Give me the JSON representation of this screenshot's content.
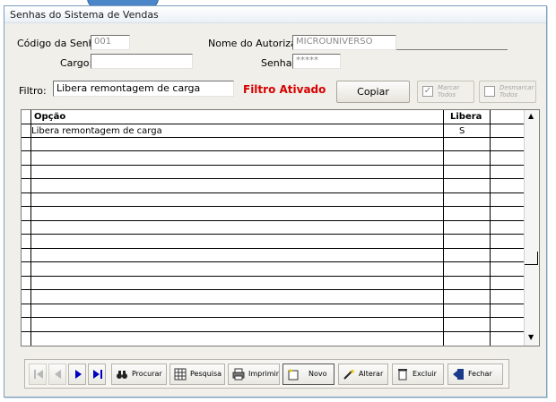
{
  "window": {
    "title": "Senhas do Sistema de Vendas"
  },
  "form": {
    "codigo_label": "Código da Senha:",
    "codigo_value": "001",
    "autorizado_label": "Nome do Autorizado:",
    "autorizado_value": "MICROUNIVERSO",
    "cargo_label": "Cargo:",
    "cargo_value": "",
    "senha_label": "Senha:",
    "senha_value": "*****"
  },
  "filter": {
    "label": "Filtro:",
    "value": "Libera remontagem de carga",
    "status": "Filtro Ativado",
    "copiar": "Copiar",
    "marcar_todos": "Marcar Todos",
    "desmarcar_todos": "Desmarcar Todos"
  },
  "grid": {
    "columns": [
      "Opção",
      "Libera"
    ],
    "rows": [
      {
        "opcao": "Libera remontagem de carga",
        "libera": "S"
      }
    ]
  },
  "toolbar": {
    "procurar": "Procurar",
    "pesquisa": "Pesquisa",
    "imprimir": "Imprimir",
    "novo": "Novo",
    "alterar": "Alterar",
    "excluir": "Excluir",
    "fechar": "Fechar"
  },
  "colors": {
    "filter_status": "#d80000",
    "nav_arrow": "#0000c0"
  }
}
